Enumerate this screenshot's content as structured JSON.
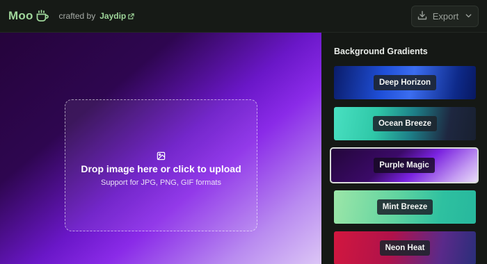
{
  "header": {
    "logo_text": "Moo",
    "crafted_by_label": "crafted by",
    "author_name": "Jaydip",
    "export_label": "Export"
  },
  "upload": {
    "title": "Drop image here or click to upload",
    "subtitle": "Support for JPG, PNG, GIF formats"
  },
  "sidebar": {
    "title": "Background Gradients",
    "gradients": [
      {
        "name": "Deep Horizon",
        "selected": false
      },
      {
        "name": "Ocean Breeze",
        "selected": false
      },
      {
        "name": "Purple Magic",
        "selected": true
      },
      {
        "name": "Mint Breeze",
        "selected": false
      },
      {
        "name": "Neon Heat",
        "selected": false
      }
    ]
  },
  "colors": {
    "accent_green": "#9fd69a",
    "app_background": "#121612"
  },
  "icons": {
    "logo": "coffee-cup-icon",
    "author_link": "external-link-icon",
    "export": "download-icon",
    "export_menu": "chevron-down-icon",
    "upload": "image-icon"
  }
}
